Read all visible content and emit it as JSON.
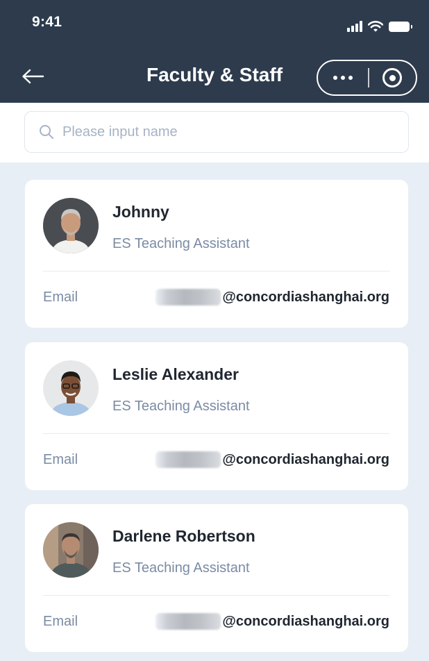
{
  "status_bar": {
    "time": "9:41"
  },
  "header": {
    "title": "Faculty & Staff"
  },
  "search": {
    "placeholder": "Please input name",
    "value": ""
  },
  "staff": [
    {
      "name": "Johnny",
      "role": "ES Teaching Assistant",
      "email_label": "Email",
      "email_domain": "@concordiashanghai.org"
    },
    {
      "name": "Leslie Alexander",
      "role": "ES Teaching Assistant",
      "email_label": "Email",
      "email_domain": "@concordiashanghai.org"
    },
    {
      "name": "Darlene Robertson",
      "role": "ES Teaching Assistant",
      "email_label": "Email",
      "email_domain": "@concordiashanghai.org"
    }
  ],
  "icons": {
    "back": "arrow-left-icon",
    "more": "more-dots-icon",
    "close": "target-circle-icon",
    "search": "search-icon"
  },
  "colors": {
    "header_bg": "#2d3b4d",
    "list_bg": "#e8eef5",
    "name_text": "#1f2630",
    "secondary_text": "#7a8ba3"
  }
}
